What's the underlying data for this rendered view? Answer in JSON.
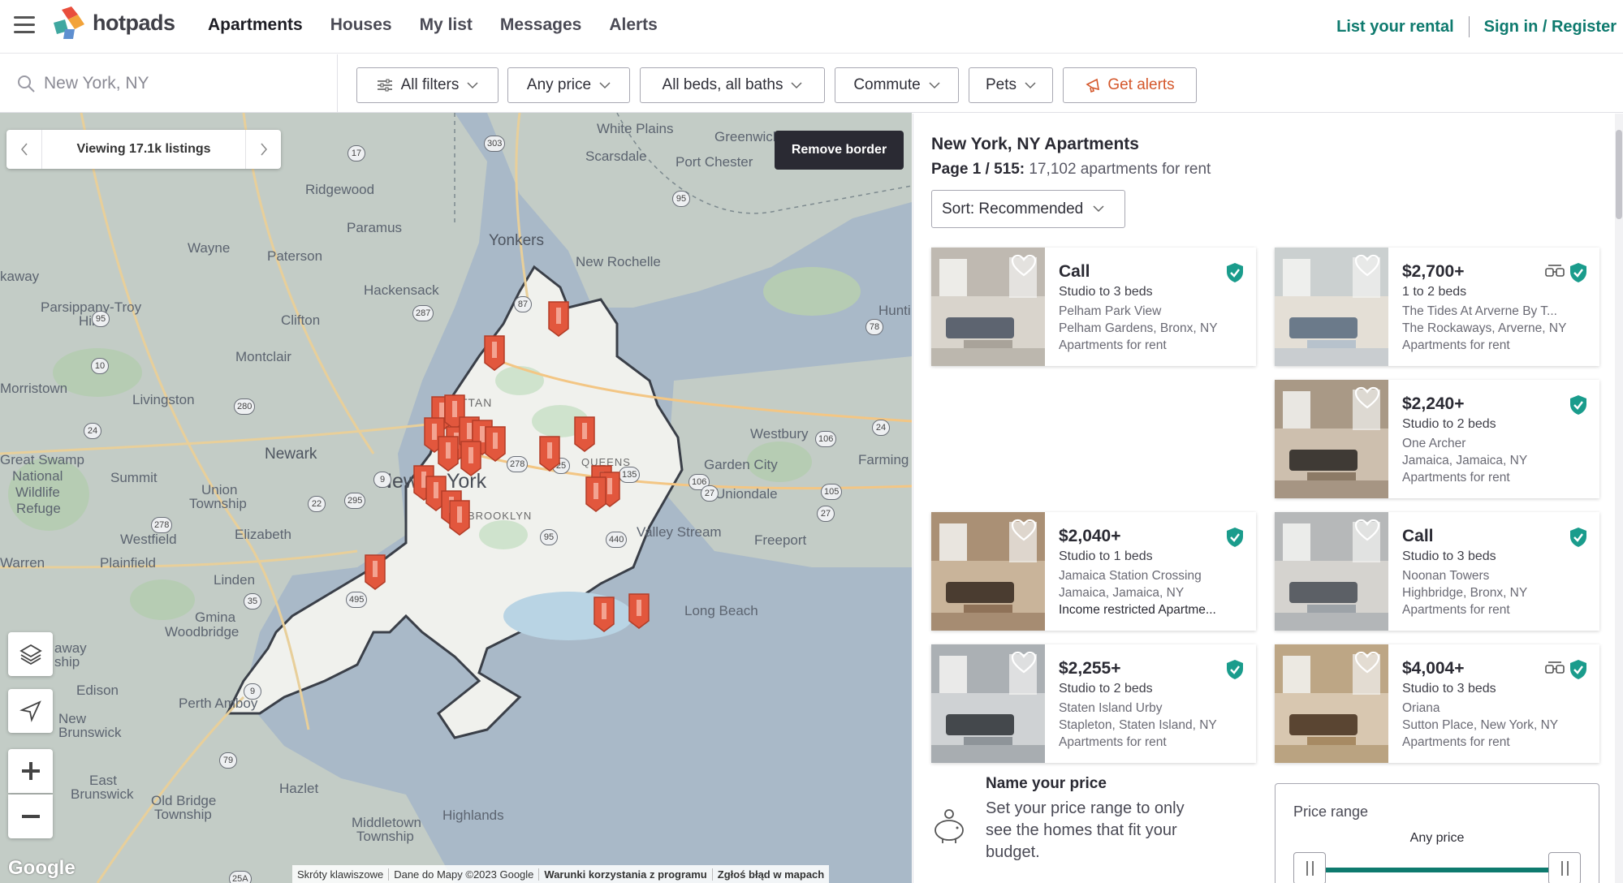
{
  "header": {
    "logo_text": "hotpads",
    "nav": [
      "Apartments",
      "Houses",
      "My list",
      "Messages",
      "Alerts"
    ],
    "list_rental": "List your rental",
    "sign_in": "Sign in / Register",
    "accent_color": "#0e7a6e"
  },
  "filters": {
    "search_placeholder": "New York, NY",
    "all_filters": "All filters",
    "price": "Any price",
    "beds": "All beds, all baths",
    "commute": "Commute",
    "pets": "Pets",
    "alerts": "Get alerts"
  },
  "map": {
    "viewing": "Viewing 17.1k listings",
    "remove_border": "Remove border",
    "labels": {
      "white_plains": "White Plains",
      "greenwich": "Greenwich",
      "scarsdale": "Scarsdale",
      "port_chester": "Port Chester",
      "ridgewood": "Ridgewood",
      "paramus": "Paramus",
      "yonkers": "Yonkers",
      "new_rochelle": "New Rochelle",
      "wayne": "Wayne",
      "paterson": "Paterson",
      "hackensack": "Hackensack",
      "kaway": "kaway",
      "parsippany": "Parsippany-Troy",
      "hills": "Hills",
      "clifton": "Clifton",
      "montclair": "Montclair",
      "huntington": "Hunti",
      "morristown": "Morristown",
      "livingston": "Livingston",
      "manhattan": "MA   TTAN",
      "westbury": "Westbury",
      "great_swamp": "Great Swamp",
      "national": "National",
      "wildlife": "Wildlife",
      "refuge": "Refuge",
      "newark": "Newark",
      "summit": "Summit",
      "union_township_1": "Union",
      "union_township_2": "Township",
      "new_york_1": "New",
      "new_york_2": "York",
      "queens": "QUEENS",
      "garden_city": "Garden City",
      "farmingdale": "Farming",
      "brooklyn": "BROOKLYN",
      "uniondale": "Uniondale",
      "elizabeth": "Elizabeth",
      "westfield": "Westfield",
      "valley_stream": "Valley Stream",
      "freeport": "Freeport",
      "warren": "Warren",
      "plainfield": "Plainfield",
      "linden": "Linden",
      "gmina_1": "Gmina",
      "gmina_2": "Woodbridge",
      "long_beach": "Long Beach",
      "away": "away",
      "ship": "ship",
      "edison": "Edison",
      "perth_amboy": "Perth Amboy",
      "new_brunswick_1": "New",
      "new_brunswick_2": "Brunswick",
      "east_brunswick_1": "East",
      "east_brunswick_2": "Brunswick",
      "old_bridge_1": "Old Bridge",
      "old_bridge_2": "Township",
      "hazlet": "Hazlet",
      "middletown_1": "Middletown",
      "middletown_2": "Township",
      "highlands": "Highlands"
    },
    "roads": [
      "303",
      "17",
      "95",
      "87",
      "287",
      "95",
      "10",
      "280",
      "24",
      "78",
      "9",
      "22",
      "278",
      "295",
      "495",
      "278",
      "25",
      "135",
      "106",
      "24",
      "106",
      "105",
      "27",
      "27",
      "95",
      "440",
      "35",
      "9",
      "79",
      "25A"
    ],
    "attribution": [
      "Skróty klawiszowe",
      "Dane do Mapy ©2023 Google",
      "Warunki korzystania z programu",
      "Zgłoś błąd w mapach"
    ],
    "google": "Google"
  },
  "results": {
    "title": "New York, NY Apartments",
    "page_prefix": "Page 1 / 515:",
    "page_suffix": "17,102 apartments for rent",
    "sort": "Sort: Recommended",
    "listings": [
      {
        "price": "Call",
        "beds": "Studio to 3 beds",
        "name": "Pelham Park View",
        "loc": "Pelham Gardens, Bronx, NY",
        "kind": "Apartments for rent",
        "tour": false
      },
      {
        "price": "$2,700+",
        "beds": "1 to 2 beds",
        "name": "The Tides At Arverne By T...",
        "loc": "The Rockaways, Arverne, NY",
        "kind": "Apartments for rent",
        "tour": true
      },
      {
        "price": "$2,240+",
        "beds": "Studio to 2 beds",
        "name": "One Archer",
        "loc": "Jamaica, Jamaica, NY",
        "kind": "Apartments for rent",
        "tour": false
      },
      {
        "price": "$2,040+",
        "beds": "Studio to 1 beds",
        "name": "Jamaica Station Crossing",
        "loc": "Jamaica, Jamaica, NY",
        "kind": "Income restricted Apartme...",
        "tour": false
      },
      {
        "price": "Call",
        "beds": "Studio to 3 beds",
        "name": "Noonan Towers",
        "loc": "Highbridge, Bronx, NY",
        "kind": "Apartments for rent",
        "tour": false
      },
      {
        "price": "$2,255+",
        "beds": "Studio to 2 beds",
        "name": "Staten Island Urby",
        "loc": "Stapleton, Staten Island, NY",
        "kind": "Apartments for rent",
        "tour": false
      },
      {
        "price": "$4,004+",
        "beds": "Studio to 3 beds",
        "name": "Oriana",
        "loc": "Sutton Place, New York, NY",
        "kind": "Apartments for rent",
        "tour": true
      }
    ],
    "promo_title": "Name your price",
    "promo_text": "Set your price range to only see the homes that fit your budget.",
    "range_label": "Price range",
    "range_value": "Any price"
  }
}
